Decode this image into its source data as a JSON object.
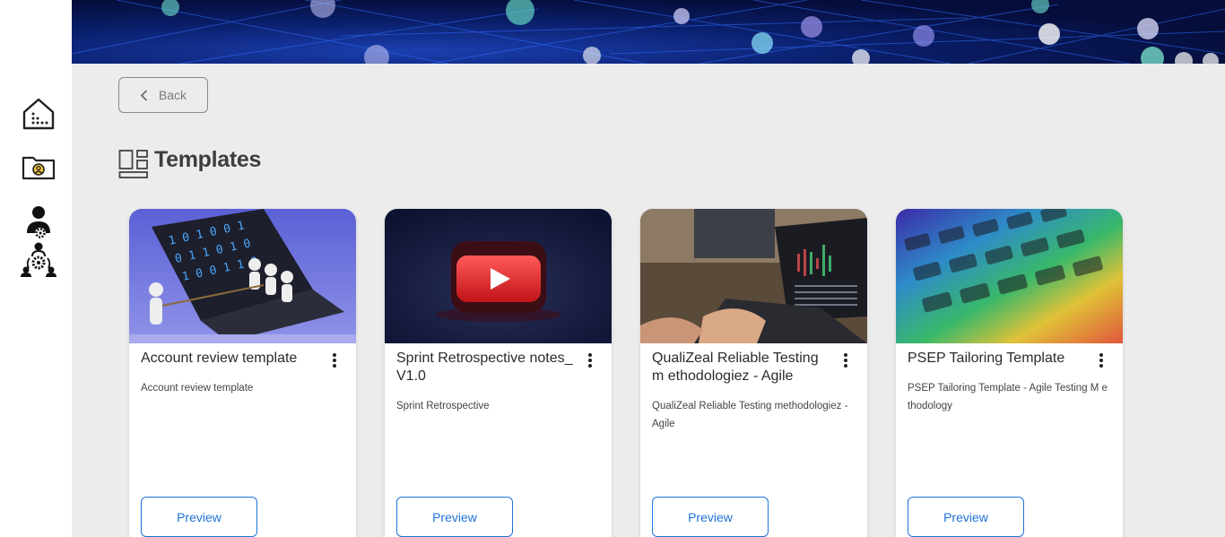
{
  "sidebar": {
    "items": [
      {
        "icon": "dashboard-house-icon"
      },
      {
        "icon": "user-folder-icon"
      },
      {
        "icon": "user-settings-icon"
      },
      {
        "icon": "team-settings-icon"
      }
    ]
  },
  "back": {
    "label": "Back"
  },
  "page": {
    "title": "Templates"
  },
  "colors": {
    "accent": "#1e73d8",
    "sidebar_bg": "#ffffff",
    "page_bg": "#ececec"
  },
  "templates": [
    {
      "title": "Account review template",
      "description": "Account review template",
      "preview_label": "Preview",
      "image": "laptop-binary-figures"
    },
    {
      "title": "Sprint Retrospective notes_ V1.0",
      "description": "Sprint Retrospective",
      "preview_label": "Preview",
      "image": "youtube-play-button"
    },
    {
      "title": "QualiZeal Reliable Testing m ethodologiez - Agile",
      "description": "QualiZeal Reliable Testing methodologiez - Agile",
      "preview_label": "Preview",
      "image": "laptop-charts"
    },
    {
      "title": "PSEP Tailoring Template",
      "description": "PSEP Tailoring Template - Agile Testing M ethodology",
      "preview_label": "Preview",
      "image": "rainbow-keyboard"
    }
  ]
}
